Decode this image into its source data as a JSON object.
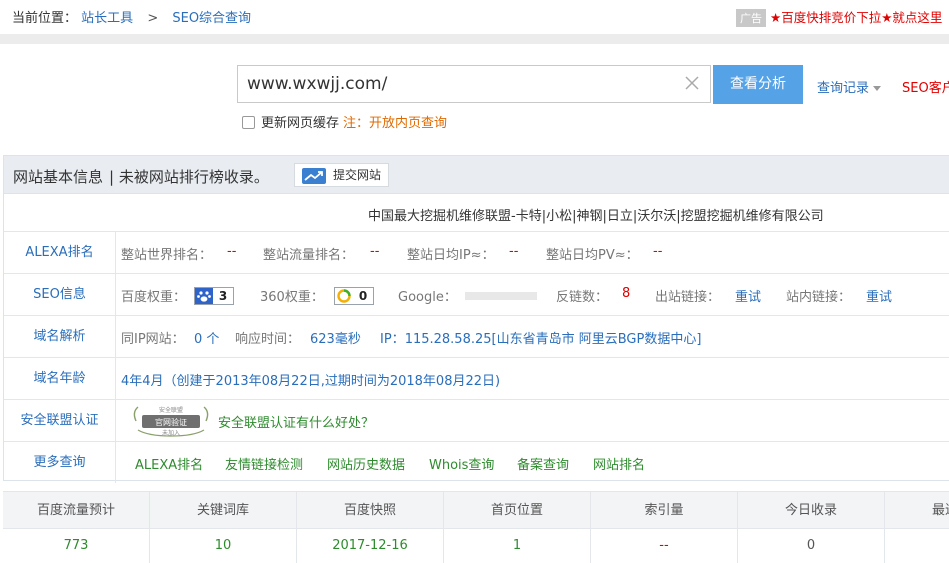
{
  "breadcrumb": {
    "current_label": "当前位置：",
    "items": [
      "站长工具",
      "SEO综合查询"
    ],
    "separator": ">"
  },
  "ad": {
    "tag": "广告",
    "text": "★百度快排竞价下拉★就点这里"
  },
  "search": {
    "value": "www.wxwjj.com/",
    "button": "查看分析",
    "history": "查询记录",
    "client": "SEO客户端",
    "refresh_cache": "更新网页缓存",
    "note": "注：开放内页查询"
  },
  "panel": {
    "title": "网站基本信息",
    "subtitle": "| 未被网站排行榜收录。",
    "submit_button": "提交网站",
    "company": "中国最大挖掘机维修联盟-卡特|小松|神钢|日立|沃尔沃|挖盟挖掘机维修有限公司"
  },
  "alexa": {
    "label": "ALEXA排名",
    "world_rank_label": "整站世界排名：",
    "world_rank": "--",
    "traffic_rank_label": "整站流量排名：",
    "traffic_rank": "--",
    "daily_ip_label": "整站日均IP≈：",
    "daily_ip": "--",
    "daily_pv_label": "整站日均PV≈：",
    "daily_pv": "--"
  },
  "seo": {
    "label": "SEO信息",
    "baidu_label": "百度权重：",
    "baidu_value": "3",
    "s360_label": "360权重：",
    "s360_value": "0",
    "google_label": "Google：",
    "backlinks_label": "反链数：",
    "backlinks": "8",
    "outlinks_label": "出站链接：",
    "outlinks": "重试",
    "inlinks_label": "站内链接：",
    "inlinks": "重试"
  },
  "dns": {
    "label": "域名解析",
    "same_ip_label": "同IP网站：",
    "same_ip": "0 个",
    "response_label": "响应时间：",
    "response": "623毫秒",
    "ip_label": "IP：",
    "ip": "115.28.58.25[山东省青岛市 阿里云BGP数据中心]"
  },
  "age": {
    "label": "域名年龄",
    "value": "4年4月（创建于2013年08月22日,过期时间为2018年08月22日)"
  },
  "security": {
    "label": "安全联盟认证",
    "seal_top": "安全联盟",
    "seal_main": "官网验证",
    "seal_bottom": "未加入",
    "link": "安全联盟认证有什么好处？"
  },
  "more": {
    "label": "更多查询",
    "links": [
      "ALEXA排名",
      "友情链接检测",
      "网站历史数据",
      "Whois查询",
      "备案查询",
      "网站排名"
    ]
  },
  "stats_table": {
    "headers": [
      "百度流量预计",
      "关键词库",
      "百度快照",
      "首页位置",
      "索引量",
      "今日收录",
      "最近"
    ],
    "values": [
      "773",
      "10",
      "2017-12-16",
      "1",
      "--",
      "0",
      ""
    ]
  },
  "colors": {
    "link": "#2a6ebb",
    "accent_button": "#55a3e6",
    "alert": "#e00000",
    "data_green": "#2e8b2e"
  }
}
